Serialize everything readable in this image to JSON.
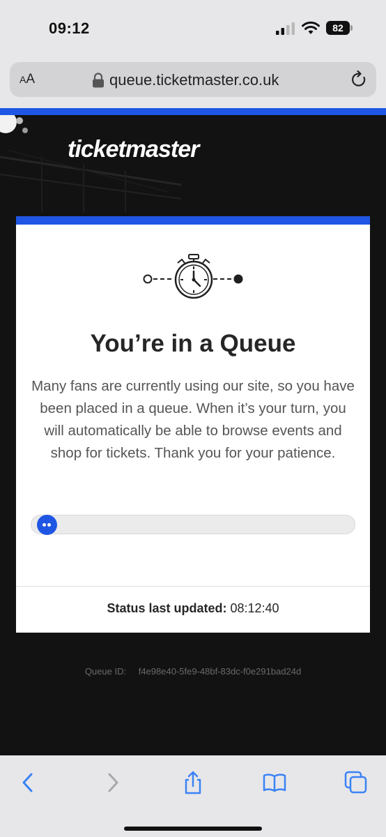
{
  "status_bar": {
    "time": "09:12",
    "battery": "82"
  },
  "browser": {
    "text_size_label_big": "A",
    "text_size_label_small": "A",
    "url": "queue.ticketmaster.co.uk"
  },
  "brand": {
    "logo_text": "ticketmaster"
  },
  "queue": {
    "title": "You’re in a Queue",
    "message": "Many fans are currently using our site, so you have been placed in a queue. When it’s your turn, you will automatically be able to browse events and shop for tickets. Thank you for your patience.",
    "progress_fraction": 0.02,
    "status_label": "Status last updated:",
    "status_time": "08:12:40",
    "queue_id_label": "Queue ID:",
    "queue_id": "f4e98e40-5fe9-48bf-83dc-f0e291bad24d"
  },
  "colors": {
    "brand_blue": "#1f56e3",
    "safari_blue": "#3b82f6",
    "background_dark": "#121212"
  },
  "icons": {
    "signal": "cellular-signal-icon",
    "wifi": "wifi-icon",
    "lock": "lock-icon",
    "reload": "reload-icon",
    "timer": "stopwatch-icon",
    "back": "chevron-left-icon",
    "forward": "chevron-right-icon",
    "share": "share-icon",
    "bookmarks": "book-icon",
    "tabs": "tabs-icon"
  }
}
